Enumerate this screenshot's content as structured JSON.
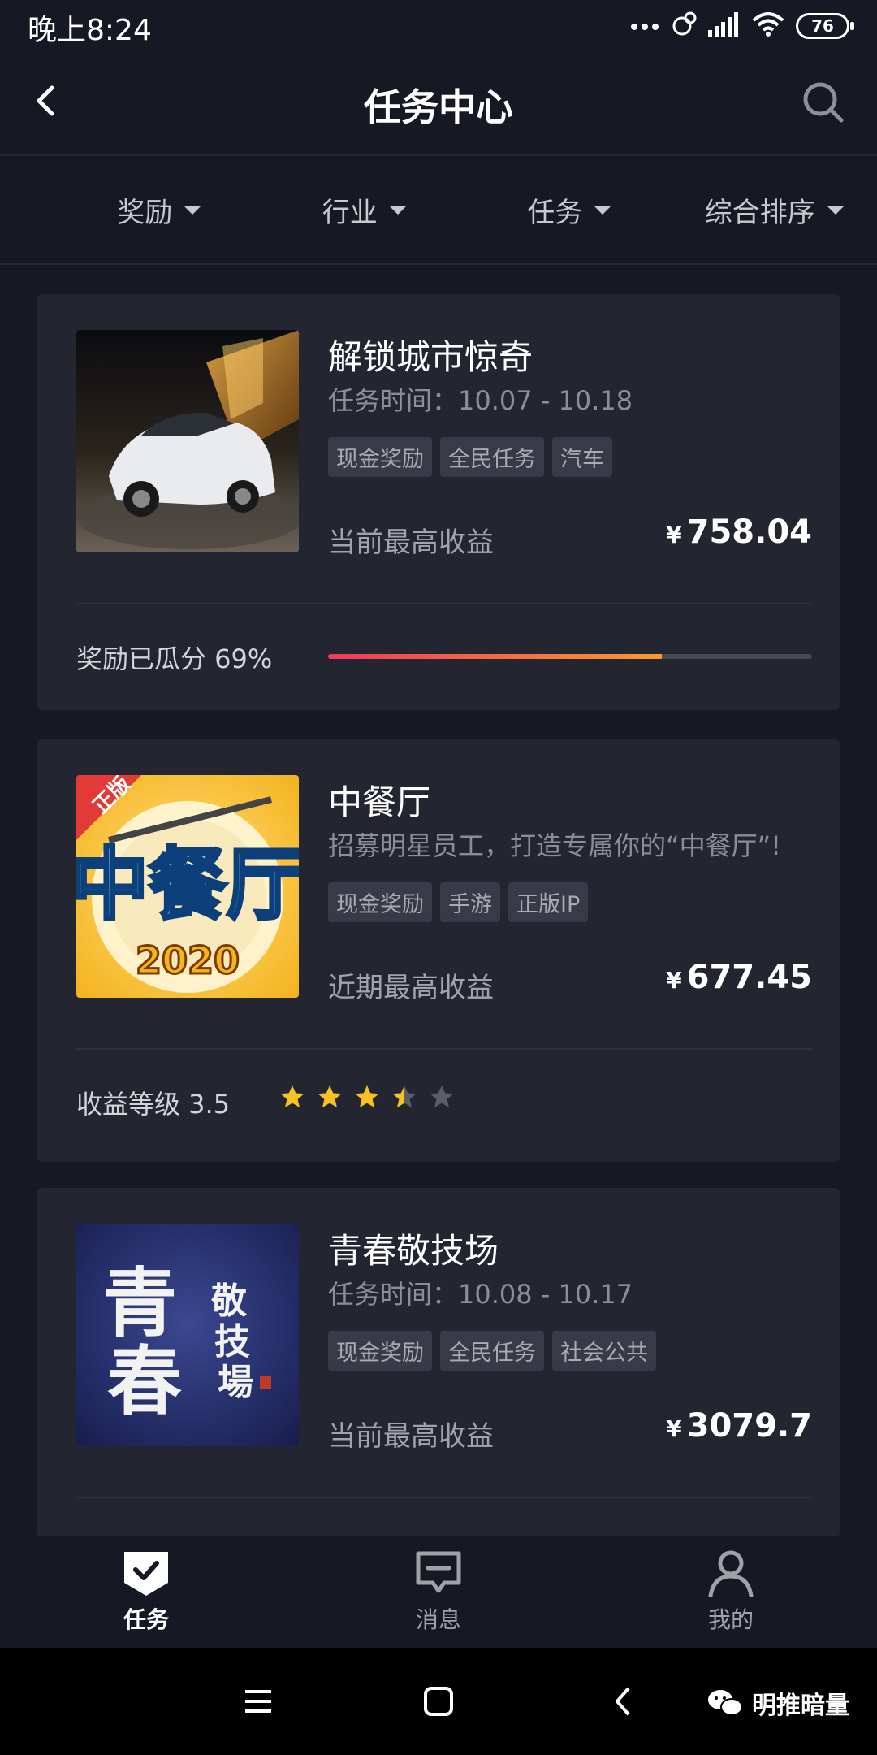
{
  "status": {
    "time": "晚上8:24",
    "battery": "76"
  },
  "header": {
    "title": "任务中心"
  },
  "filters": [
    "奖励",
    "行业",
    "任务",
    "综合排序"
  ],
  "tasks": [
    {
      "title": "解锁城市惊奇",
      "subtitle": "任务时间：10.07 - 10.18",
      "tags": [
        "现金奖励",
        "全民任务",
        "汽车"
      ],
      "earn_label": "当前最高收益",
      "currency": "¥",
      "earn_value": "758.04",
      "footer_label": "奖励已瓜分 69%",
      "progress": 0.69
    },
    {
      "title": "中餐厅",
      "subtitle": "招募明星员工，打造专属你的“中餐厅”!",
      "tags": [
        "现金奖励",
        "手游",
        "正版IP"
      ],
      "earn_label": "近期最高收益",
      "currency": "¥",
      "earn_value": "677.45",
      "footer_label": "收益等级 3.5",
      "rating": 3.5,
      "thumb_badge": "正版",
      "thumb_year": "2020"
    },
    {
      "title": "青春敬技场",
      "subtitle": "任务时间：10.08 - 10.17",
      "tags": [
        "现金奖励",
        "全民任务",
        "社会公共"
      ],
      "earn_label": "当前最高收益",
      "currency": "¥",
      "earn_value": "3079.7"
    }
  ],
  "tabbar": [
    {
      "label": "任务",
      "icon": "task-icon",
      "active": true
    },
    {
      "label": "消息",
      "icon": "message-icon",
      "active": false
    },
    {
      "label": "我的",
      "icon": "profile-icon",
      "active": false
    }
  ],
  "watermark": "明推暗量",
  "colors": {
    "background": "#161823",
    "card": "#232530",
    "star": "#f6c224",
    "progress_start": "#f1395a",
    "progress_end": "#f89a2c"
  }
}
